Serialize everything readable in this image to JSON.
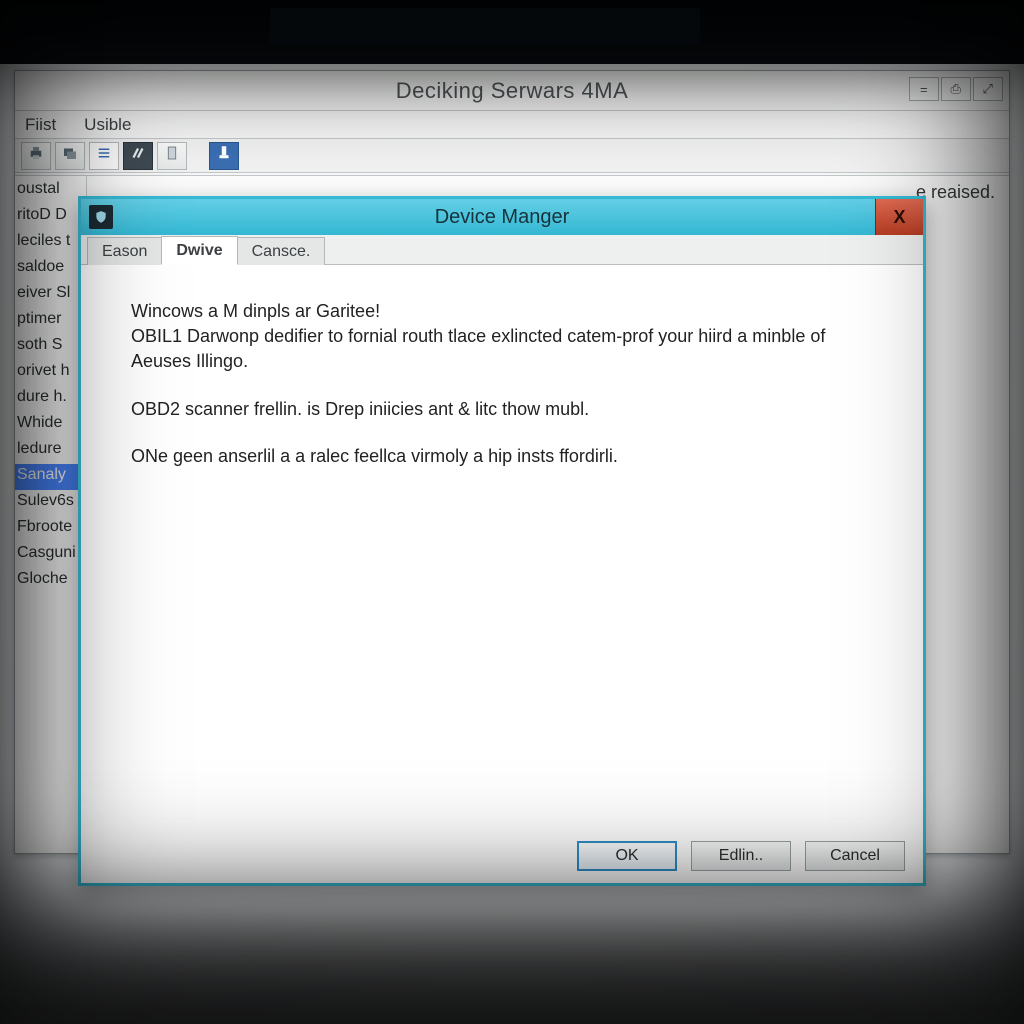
{
  "parent_window": {
    "title": "Deciking Serwars 4MA",
    "sys_buttons": {
      "a": "=",
      "b": "⎙",
      "c": "⤢"
    },
    "menu": [
      "Fiist",
      "Usible"
    ],
    "rt_text": "e reaised."
  },
  "side_items": [
    "oustal",
    "ritoD D",
    "leciles t",
    "saldoe",
    "eiver Sl",
    "ptimer",
    "soth S",
    "orivet h",
    "dure h.",
    "Whide",
    "ledure",
    "Sanaly",
    "Sulev6s",
    "Fbroote",
    "Casguni",
    "Gloche"
  ],
  "side_selected_index": 11,
  "dialog": {
    "title": "Device Manger",
    "close_glyph": "X",
    "tabs": [
      "Eason",
      "Dwive",
      "Cansce."
    ],
    "active_tab_index": 1,
    "paragraphs": [
      "Wincows a M dinpls ar Garitee!",
      "OBIL1 Darwonp dedifier to fornial routh tlace exlincted catem-prof your hiird a minble of Aeuses Illingo.",
      "OBD2 scanner frellin. is Drep iniicies ant & litc thow mubl.",
      "ONe geen anserlil a a ralec feellca virmoly a hip insts ffordirli."
    ],
    "buttons": {
      "ok": "OK",
      "edlin": "Edlin..",
      "cancel": "Cancel"
    }
  }
}
